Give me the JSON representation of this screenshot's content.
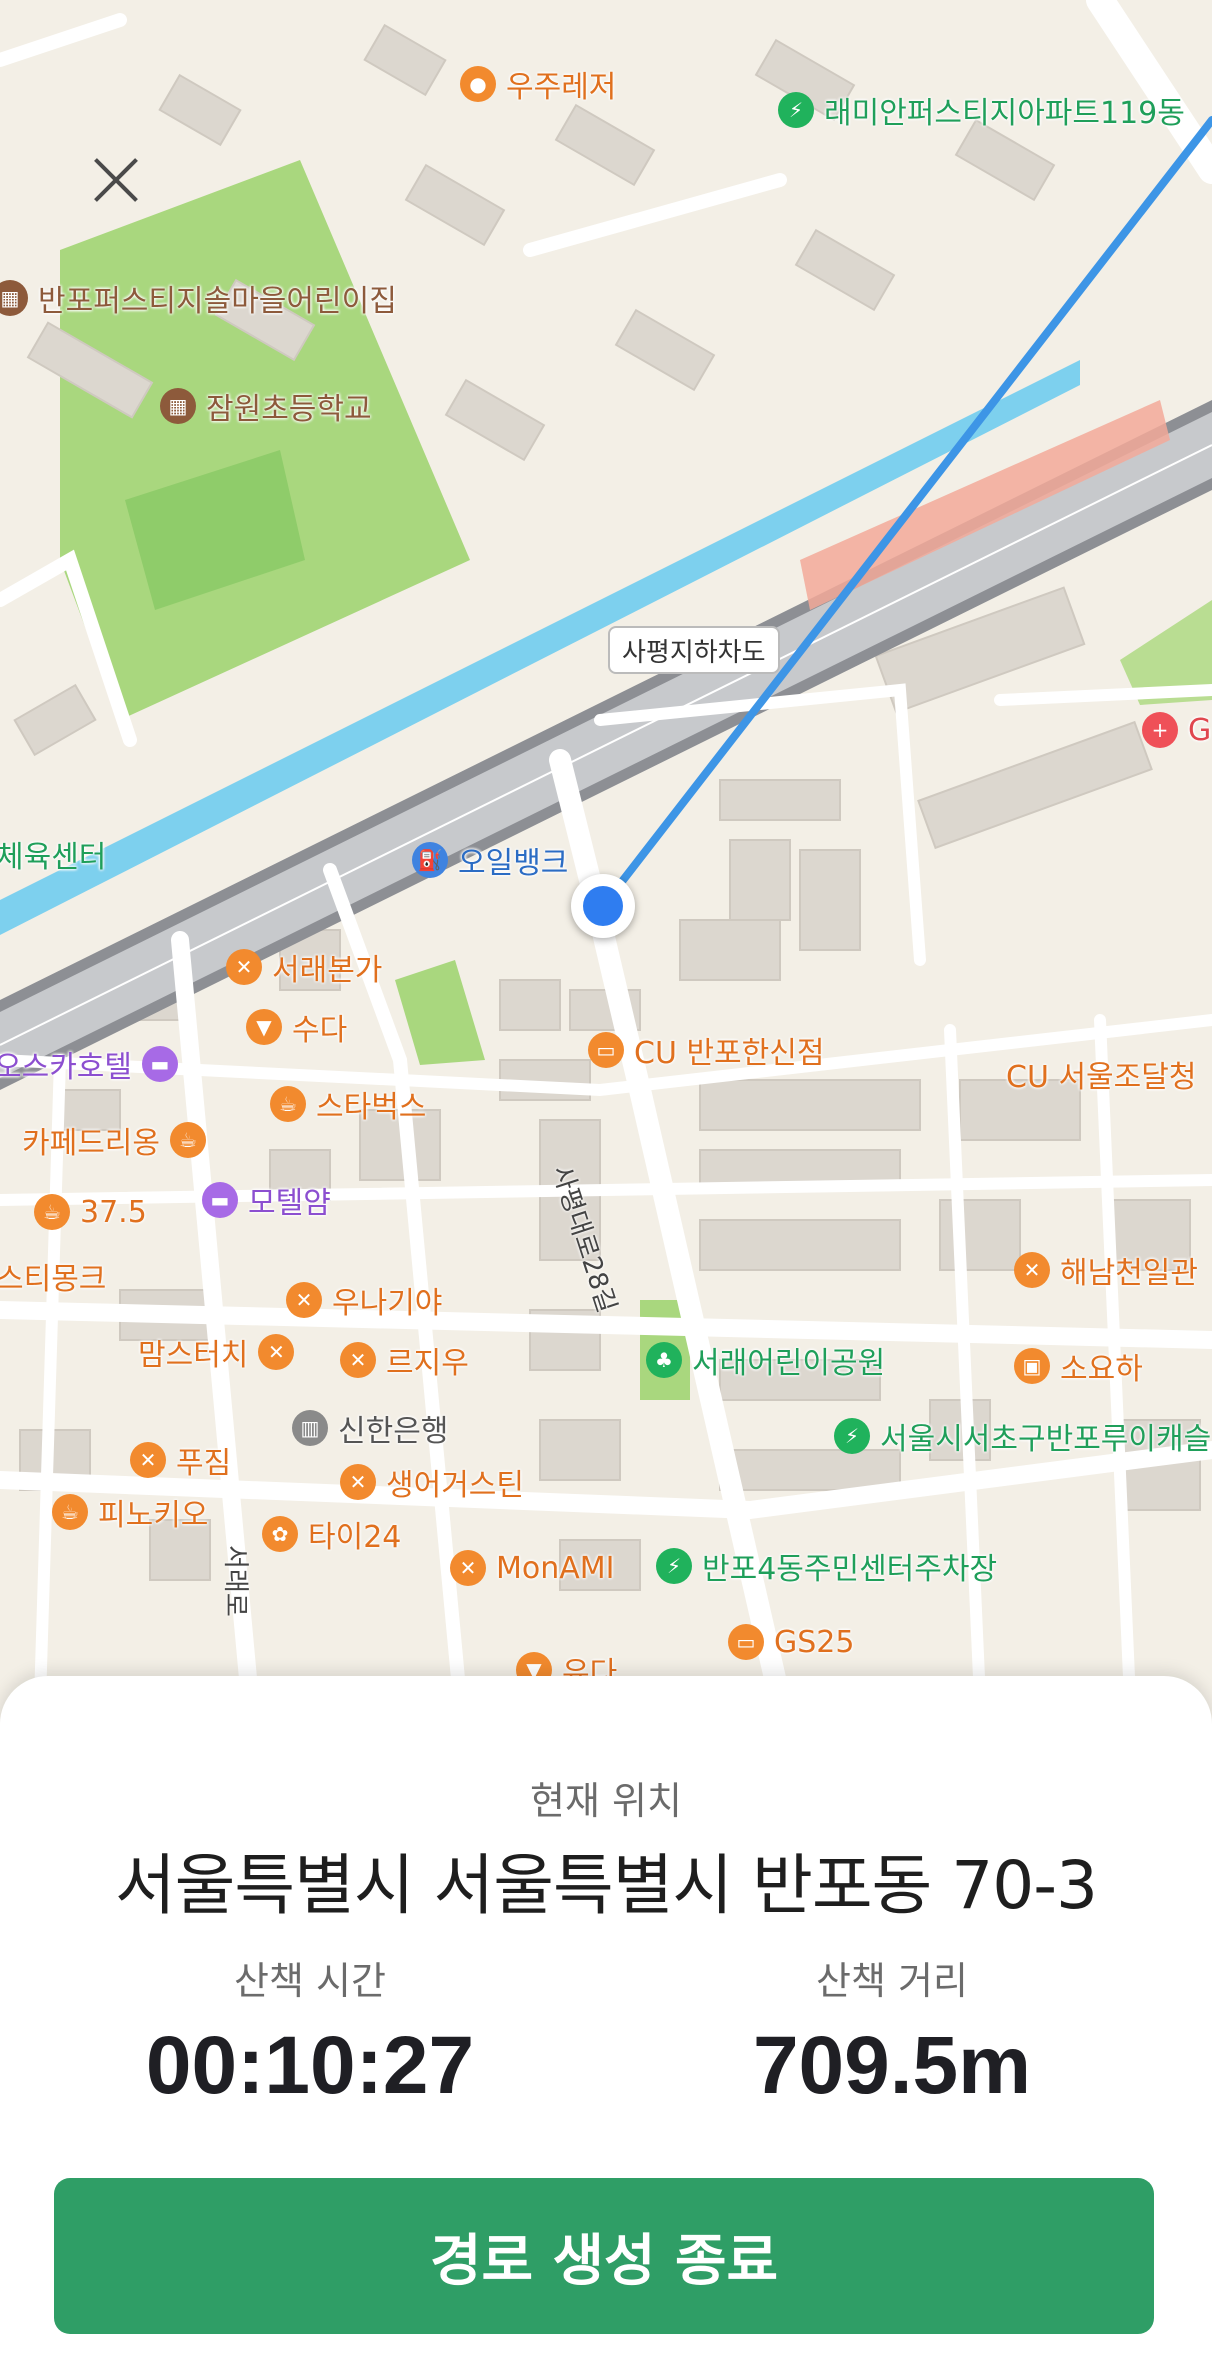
{
  "map": {
    "underpass_label": "사평지하차도",
    "streets": {
      "sapyeong_28": "사평대로28길",
      "seorae_ro": "서래로"
    },
    "pois": {
      "woojuleisure": "우주레저",
      "raemian": "래미안퍼스티지아파트119동",
      "daycare": "반포퍼스티지솔마을어린이집",
      "jamwon_school": "잠원초등학교",
      "sports_center": "체육센터",
      "oilbank": "오일뱅크",
      "gs_partial": "GI",
      "seorae_bonga": "서래본가",
      "suda": "수다",
      "starbucks": "스타벅스",
      "cu_banpo": "CU 반포한신점",
      "cu_seoul": "CU 서울조달청",
      "oska_hotel": "오스카호텔",
      "cafe_drio": "카페드리옹",
      "motel_yam": "모텔얌",
      "cafe375": "37.5",
      "stimonk": "스티몽크",
      "haenam": "해남천일관",
      "unagiya": "우나기야",
      "mamstouch": "맘스터치",
      "lejiwoo": "르지우",
      "seorae_park": "서래어린이공원",
      "soyoha": "소요하",
      "shinhan": "신한은행",
      "banpo_parking1": "서울시서초구반포루이캐슬",
      "pujim": "푸짐",
      "salmon": "생어거스틴",
      "pinocchio": "피노키오",
      "tai24": "타이24",
      "monami": "MonAMI",
      "banpo4_center": "반포4동주민센터주차장",
      "gs25": "GS25",
      "yuda": "유다"
    }
  },
  "sheet": {
    "current_label": "현재 위치",
    "address": "서울특별시 서울특별시 반포동 70-3",
    "walk_time_label": "산책 시간",
    "walk_time": "00:10:27",
    "walk_distance_label": "산책 거리",
    "walk_distance": "709.5m",
    "end_button": "경로 생성 종료"
  },
  "colors": {
    "accent": "#2f9e66",
    "route": "#3d95e6",
    "location": "#2f7df0"
  }
}
